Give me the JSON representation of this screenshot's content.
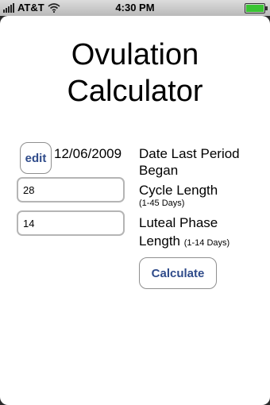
{
  "status_bar": {
    "carrier": "AT&T",
    "time": "4:30 PM",
    "wifi_icon": "wifi-icon",
    "battery_color": "#39c433"
  },
  "app": {
    "title_line1": "Ovulation",
    "title_line2": "Calculator"
  },
  "form": {
    "edit_label": "edit",
    "last_period_date": "12/06/2009",
    "last_period_label_line1": "Date Last Period",
    "last_period_label_line2": "Began",
    "cycle_length_value": "28",
    "cycle_length_label": "Cycle Length",
    "cycle_length_hint": "(1-45 Days)",
    "luteal_phase_value": "14",
    "luteal_phase_label_line1": "Luteal Phase",
    "luteal_phase_label_line2": "Length",
    "luteal_phase_hint": "(1-14 Days)",
    "calculate_label": "Calculate"
  }
}
